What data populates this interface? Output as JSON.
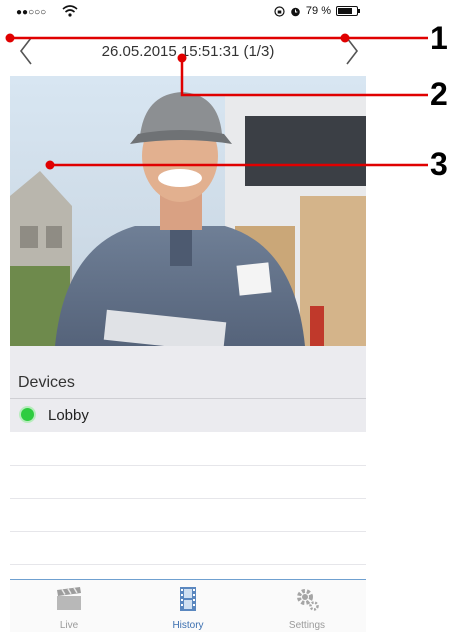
{
  "status_bar": {
    "signal": "●●○○○",
    "battery_percent": "79 %",
    "battery_level": 0.79
  },
  "navigation": {
    "title": "26.05.2015 15:51:31 (1/3)",
    "prev_icon": "chevron-left-icon",
    "next_icon": "chevron-right-icon"
  },
  "snapshot": {
    "icon": "delivery-person-photo"
  },
  "devices": {
    "header": "Devices",
    "items": [
      {
        "name": "Lobby",
        "status_color": "#2ecc40"
      }
    ]
  },
  "tabs": [
    {
      "label": "Live",
      "icon": "clapperboard-icon",
      "active": false
    },
    {
      "label": "History",
      "icon": "film-strip-icon",
      "active": true
    },
    {
      "label": "Settings",
      "icon": "gears-icon",
      "active": false
    }
  ],
  "callouts": [
    "1",
    "2",
    "3"
  ],
  "colors": {
    "callout_line": "#e00000",
    "accent": "#3b6fb0",
    "online": "#2ecc40"
  }
}
